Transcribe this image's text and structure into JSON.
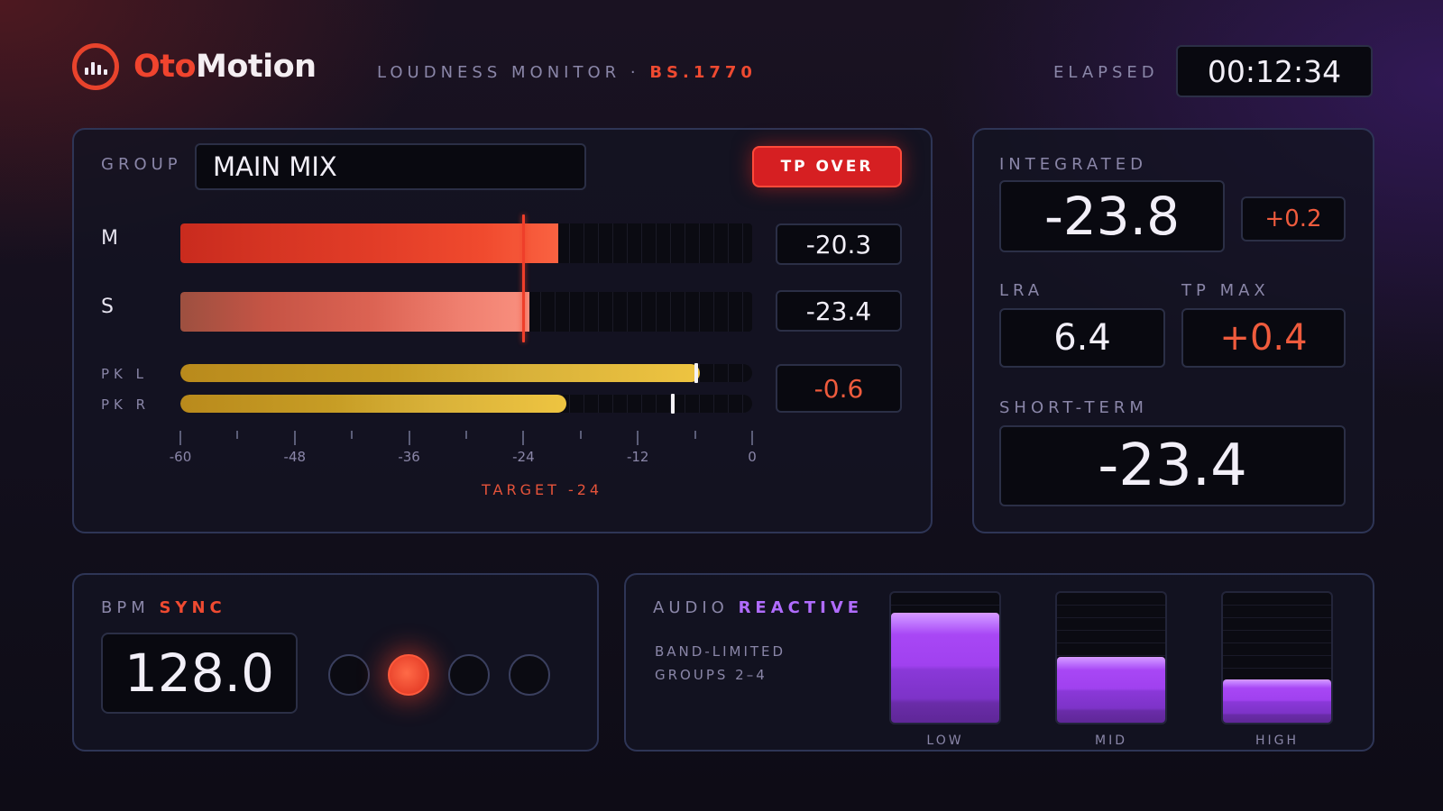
{
  "brand": {
    "part1": "Oto",
    "part2": "Motion"
  },
  "header": {
    "subtitle": "LOUDNESS MONITOR · ",
    "standard": "BS.1770",
    "elapsed_label": "ELAPSED",
    "elapsed": "00:12:34"
  },
  "meter": {
    "group_label": "GROUP",
    "group_name": "MAIN MIX",
    "tp_over_label": "TP OVER",
    "channels": [
      {
        "label": "M",
        "value": "-20.3",
        "level": -20.3
      },
      {
        "label": "S",
        "value": "-23.4",
        "level": -23.4
      }
    ],
    "peaks": [
      {
        "label": "PK L",
        "level": -5.5,
        "hold": -5.9
      },
      {
        "label": "PK R",
        "level": -19.5,
        "hold": -8.3
      }
    ],
    "peak_value": "-0.6",
    "scale": [
      "-60",
      "-48",
      "-36",
      "-24",
      "-12",
      "0"
    ],
    "target_label": "TARGET -24",
    "target": -24
  },
  "stats": {
    "integrated_label": "INTEGRATED",
    "integrated": "-23.8",
    "integrated_delta": "+0.2",
    "lra_label": "LRA",
    "lra": "6.4",
    "tp_max_label": "TP MAX",
    "tp_max": "+0.4",
    "short_term_label": "SHORT-TERM",
    "short_term": "-23.4"
  },
  "bpm": {
    "label": "BPM",
    "label_hl": "SYNC",
    "value": "128.0",
    "beats": [
      false,
      true,
      false,
      false
    ]
  },
  "audio_reactive": {
    "label": "AUDIO",
    "label_hl": "REACTIVE",
    "line1": "BAND-LIMITED",
    "line2": "GROUPS 2–4",
    "bands": [
      {
        "label": "LOW",
        "level": 0.85
      },
      {
        "label": "MID",
        "level": 0.51
      },
      {
        "label": "HIGH",
        "level": 0.33
      }
    ]
  },
  "colors": {
    "accent_red": "#ef4a31",
    "accent_purple": "#b06cff",
    "peak_yellow": "#eec441"
  }
}
